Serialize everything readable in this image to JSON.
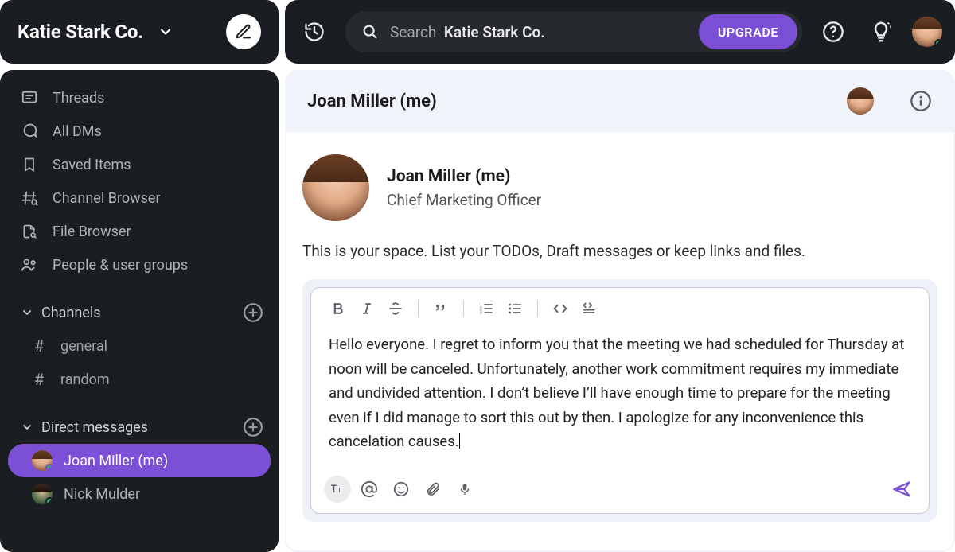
{
  "workspace": {
    "name": "Katie Stark Co."
  },
  "sidebar": {
    "nav": [
      {
        "label": "Threads",
        "icon": "threads-icon"
      },
      {
        "label": "All DMs",
        "icon": "all-dms-icon"
      },
      {
        "label": "Saved Items",
        "icon": "bookmark-icon"
      },
      {
        "label": "Channel Browser",
        "icon": "channel-browser-icon"
      },
      {
        "label": "File Browser",
        "icon": "file-browser-icon"
      },
      {
        "label": "People & user groups",
        "icon": "people-icon"
      }
    ],
    "channels_section": "Channels",
    "channels": [
      {
        "name": "general"
      },
      {
        "name": "random"
      }
    ],
    "dms_section": "Direct messages",
    "dms": [
      {
        "name": "Joan Miller (me)",
        "active": true,
        "online": true
      },
      {
        "name": "Nick Mulder",
        "active": false,
        "online": true
      }
    ]
  },
  "topbar": {
    "search_prefix": "Search",
    "search_workspace": "Katie Stark Co.",
    "upgrade": "UPGRADE"
  },
  "chat": {
    "header_title": "Joan Miller (me)",
    "profile_name": "Joan Miller (me)",
    "profile_role": "Chief Marketing Officer",
    "space_desc": "This is your space. List your TODOs, Draft messages or keep links and files."
  },
  "composer": {
    "draft": "Hello everyone. I regret to inform you that the meeting we had scheduled for Thursday at noon will be canceled. Unfortunately, another work commitment requires my immediate and undivided attention. I don’t believe I’ll have enough time to prepare for the meeting even if I did manage to sort this out by then. I apologize for any inconvenience this cancelation causes."
  },
  "colors": {
    "accent": "#7b4fd6",
    "presence": "#2bac76"
  }
}
